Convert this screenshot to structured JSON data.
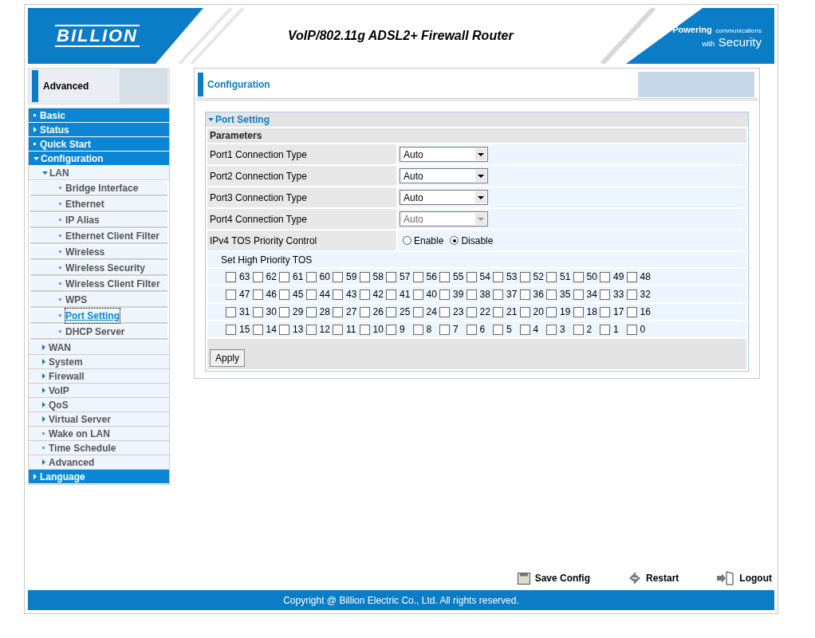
{
  "header": {
    "logo": "BILLION",
    "title": "VoIP/802.11g ADSL2+ Firewall Router",
    "slogan_1": "Powering",
    "slogan_2": "communications",
    "slogan_3": "with",
    "slogan_4": "Security"
  },
  "sidebar": {
    "banner": "Advanced",
    "items": [
      {
        "label": "Basic",
        "selected": false
      },
      {
        "label": "Status",
        "expanded": false,
        "selected": false
      },
      {
        "label": "Quick Start",
        "selected": false
      },
      {
        "label": "Configuration",
        "expanded": true,
        "selected": false,
        "children": [
          {
            "label": "LAN",
            "expanded": true,
            "selected": false,
            "children": [
              {
                "label": "Bridge Interface",
                "selected": false
              },
              {
                "label": "Ethernet",
                "selected": false
              },
              {
                "label": "IP Alias",
                "selected": false
              },
              {
                "label": "Ethernet Client Filter",
                "selected": false
              },
              {
                "label": "Wireless",
                "selected": false
              },
              {
                "label": "Wireless Security",
                "selected": false
              },
              {
                "label": "Wireless Client Filter",
                "selected": false
              },
              {
                "label": "WPS",
                "selected": false
              },
              {
                "label": "Port Setting",
                "selected": true
              },
              {
                "label": "DHCP Server",
                "selected": false
              }
            ]
          },
          {
            "label": "WAN",
            "expanded": false,
            "selected": false
          },
          {
            "label": "System",
            "expanded": false,
            "selected": false
          },
          {
            "label": "Firewall",
            "expanded": false,
            "selected": false
          },
          {
            "label": "VoIP",
            "expanded": false,
            "selected": false
          },
          {
            "label": "QoS",
            "expanded": false,
            "selected": false
          },
          {
            "label": "Virtual Server",
            "expanded": false,
            "selected": false
          },
          {
            "label": "Wake on LAN",
            "selected": false
          },
          {
            "label": "Time Schedule",
            "selected": false
          },
          {
            "label": "Advanced",
            "expanded": false,
            "selected": false
          }
        ]
      },
      {
        "label": "Language",
        "expanded": false,
        "selected": false
      }
    ]
  },
  "content": {
    "title": "Configuration",
    "section": "Port Setting",
    "parameters": "Parameters",
    "ports": [
      {
        "label": "Port1 Connection Type",
        "value": "Auto",
        "disabled": false
      },
      {
        "label": "Port2 Connection Type",
        "value": "Auto",
        "disabled": false
      },
      {
        "label": "Port3 Connection Type",
        "value": "Auto",
        "disabled": false
      },
      {
        "label": "Port4 Connection Type",
        "value": "Auto",
        "disabled": true
      }
    ],
    "tos_control": {
      "label": "IPv4 TOS Priority Control",
      "options": [
        {
          "label": "Enable",
          "selected": false
        },
        {
          "label": "Disable",
          "selected": true
        }
      ]
    },
    "tos_heading": "Set High Priority TOS",
    "tos_rows": [
      [
        {
          "label": "63",
          "checked": false
        },
        {
          "label": "62",
          "checked": false
        },
        {
          "label": "61",
          "checked": false
        },
        {
          "label": "60",
          "checked": false
        },
        {
          "label": "59",
          "checked": false
        },
        {
          "label": "58",
          "checked": false
        },
        {
          "label": "57",
          "checked": false
        },
        {
          "label": "56",
          "checked": false
        },
        {
          "label": "55",
          "checked": false
        },
        {
          "label": "54",
          "checked": false
        },
        {
          "label": "53",
          "checked": false
        },
        {
          "label": "52",
          "checked": false
        },
        {
          "label": "51",
          "checked": false
        },
        {
          "label": "50",
          "checked": false
        },
        {
          "label": "49",
          "checked": false
        },
        {
          "label": "48",
          "checked": false
        }
      ],
      [
        {
          "label": "47",
          "checked": false
        },
        {
          "label": "46",
          "checked": false
        },
        {
          "label": "45",
          "checked": false
        },
        {
          "label": "44",
          "checked": false
        },
        {
          "label": "43",
          "checked": false
        },
        {
          "label": "42",
          "checked": false
        },
        {
          "label": "41",
          "checked": false
        },
        {
          "label": "40",
          "checked": false
        },
        {
          "label": "39",
          "checked": false
        },
        {
          "label": "38",
          "checked": false
        },
        {
          "label": "37",
          "checked": false
        },
        {
          "label": "36",
          "checked": false
        },
        {
          "label": "35",
          "checked": false
        },
        {
          "label": "34",
          "checked": false
        },
        {
          "label": "33",
          "checked": false
        },
        {
          "label": "32",
          "checked": false
        }
      ],
      [
        {
          "label": "31",
          "checked": false
        },
        {
          "label": "30",
          "checked": false
        },
        {
          "label": "29",
          "checked": false
        },
        {
          "label": "28",
          "checked": false
        },
        {
          "label": "27",
          "checked": false
        },
        {
          "label": "26",
          "checked": false
        },
        {
          "label": "25",
          "checked": false
        },
        {
          "label": "24",
          "checked": false
        },
        {
          "label": "23",
          "checked": false
        },
        {
          "label": "22",
          "checked": false
        },
        {
          "label": "21",
          "checked": false
        },
        {
          "label": "20",
          "checked": false
        },
        {
          "label": "19",
          "checked": false
        },
        {
          "label": "18",
          "checked": false
        },
        {
          "label": "17",
          "checked": false
        },
        {
          "label": "16",
          "checked": false
        }
      ],
      [
        {
          "label": "15",
          "checked": false
        },
        {
          "label": "14",
          "checked": false
        },
        {
          "label": "13",
          "checked": false
        },
        {
          "label": "12",
          "checked": false
        },
        {
          "label": "11",
          "checked": false
        },
        {
          "label": "10",
          "checked": false
        },
        {
          "label": "9",
          "checked": false
        },
        {
          "label": "8",
          "checked": false
        },
        {
          "label": "7",
          "checked": false
        },
        {
          "label": "6",
          "checked": false
        },
        {
          "label": "5",
          "checked": false
        },
        {
          "label": "4",
          "checked": false
        },
        {
          "label": "3",
          "checked": false
        },
        {
          "label": "2",
          "checked": false
        },
        {
          "label": "1",
          "checked": false
        },
        {
          "label": "0",
          "checked": false
        }
      ]
    ],
    "apply": "Apply"
  },
  "actions": [
    {
      "kind": "save",
      "label": "Save Config"
    },
    {
      "kind": "restart",
      "label": "Restart"
    },
    {
      "kind": "logout",
      "label": "Logout"
    }
  ],
  "footer": "Copyright @ Billion Electric Co., Ltd. All rights reserved."
}
